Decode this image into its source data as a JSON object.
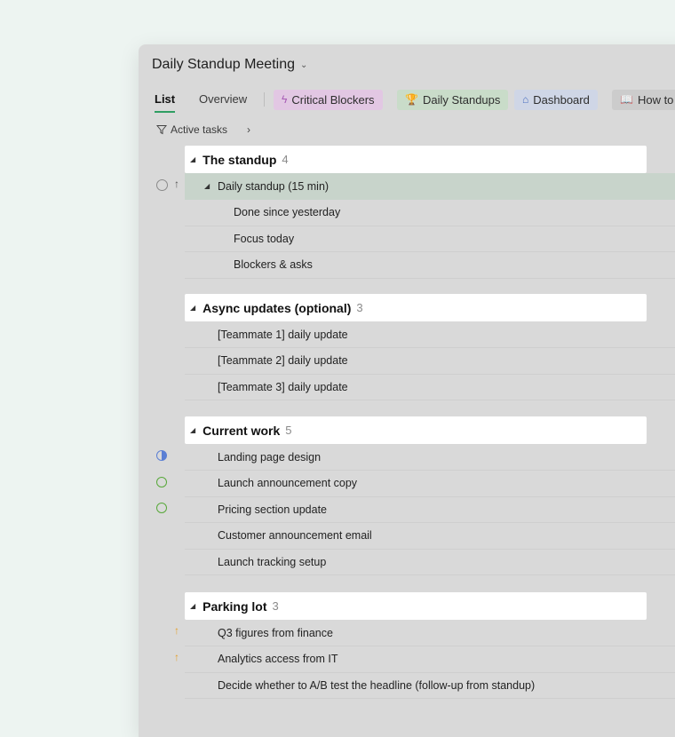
{
  "window": {
    "title": "Daily Standup Meeting"
  },
  "tabs": {
    "list": "List",
    "overview": "Overview",
    "chips": [
      {
        "label": "Critical Blockers",
        "icon": "lightning-icon",
        "glyph": "ϟ",
        "bg": "#e2c7e3",
        "iconColor": "#a75bb5"
      },
      {
        "label": "Daily Standups",
        "icon": "trophy-icon",
        "glyph": "🏆",
        "bg": "#c9dcc9",
        "iconColor": "#3f8f55"
      },
      {
        "label": "Dashboard",
        "icon": "home-icon",
        "glyph": "⌂",
        "bg": "#cfd6e6",
        "iconColor": "#4a6fc0"
      },
      {
        "label": "How to",
        "icon": "book-icon",
        "glyph": "📖",
        "bg": "#cccccc",
        "iconColor": "#555555"
      }
    ]
  },
  "filter": {
    "label": "Active tasks"
  },
  "sections": [
    {
      "name": "The standup",
      "count": "4",
      "rows": [
        {
          "label": "Daily standup (15 min)",
          "selected": true,
          "collapsible": true
        },
        {
          "label": "Done since yesterday",
          "indent": 2
        },
        {
          "label": "Focus today",
          "indent": 2
        },
        {
          "label": "Blockers & asks",
          "indent": 2
        }
      ]
    },
    {
      "name": "Async updates (optional)",
      "count": "3",
      "rows": [
        {
          "label": "[Teammate 1] daily update"
        },
        {
          "label": "[Teammate 2] daily update"
        },
        {
          "label": "[Teammate 3] daily update"
        }
      ]
    },
    {
      "name": "Current work",
      "count": "5",
      "rows": [
        {
          "label": "Landing page design",
          "status": "half-circle-icon"
        },
        {
          "label": "Launch announcement copy",
          "status": "timer-icon"
        },
        {
          "label": "Pricing section update",
          "status": "timer-icon"
        },
        {
          "label": "Customer announcement email"
        },
        {
          "label": "Launch tracking setup"
        }
      ]
    },
    {
      "name": "Parking lot",
      "count": "3",
      "rows": [
        {
          "label": "Q3 figures from finance",
          "priority": "up-arrow-icon"
        },
        {
          "label": "Analytics access from IT",
          "priority": "up-arrow-icon"
        },
        {
          "label": "Decide whether to A/B test the headline (follow-up from standup)"
        }
      ]
    }
  ]
}
